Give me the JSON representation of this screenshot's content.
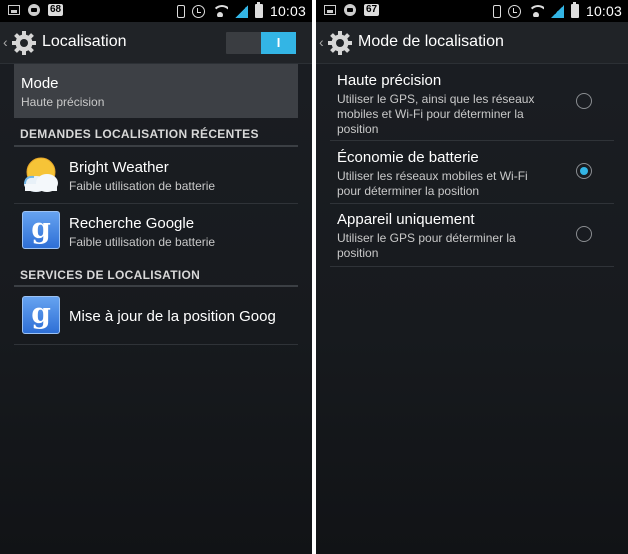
{
  "status_bar": {
    "left_count": "68",
    "right_count": "67",
    "time": "10:03"
  },
  "left": {
    "title": "Localisation",
    "toggle_label": "I",
    "mode": {
      "title": "Mode",
      "subtitle": "Haute précision"
    },
    "sections": [
      {
        "header": "DEMANDES LOCALISATION RÉCENTES",
        "items": [
          {
            "title": "Bright Weather",
            "subtitle": "Faible utilisation de batterie",
            "icon": "weather-app-icon"
          },
          {
            "title": "Recherche Google",
            "subtitle": "Faible utilisation de batterie",
            "icon": "google-app-icon"
          }
        ]
      },
      {
        "header": "SERVICES DE LOCALISATION",
        "items": [
          {
            "title": "Mise à jour de la position Goog",
            "icon": "google-app-icon"
          }
        ]
      }
    ]
  },
  "right": {
    "title": "Mode de localisation",
    "options": [
      {
        "title": "Haute précision",
        "description": "Utiliser le GPS, ainsi que les réseaux mobiles et Wi-Fi pour déterminer la position",
        "selected": false
      },
      {
        "title": "Économie de batterie",
        "description": "Utiliser les réseaux mobiles et Wi-Fi pour déterminer la position",
        "selected": true
      },
      {
        "title": "Appareil uniquement",
        "description": "Utiliser le GPS pour déterminer la position",
        "selected": false
      }
    ]
  },
  "colors": {
    "accent": "#33b5e5",
    "background": "#1b1e23",
    "selected_row": "#3d4045"
  }
}
